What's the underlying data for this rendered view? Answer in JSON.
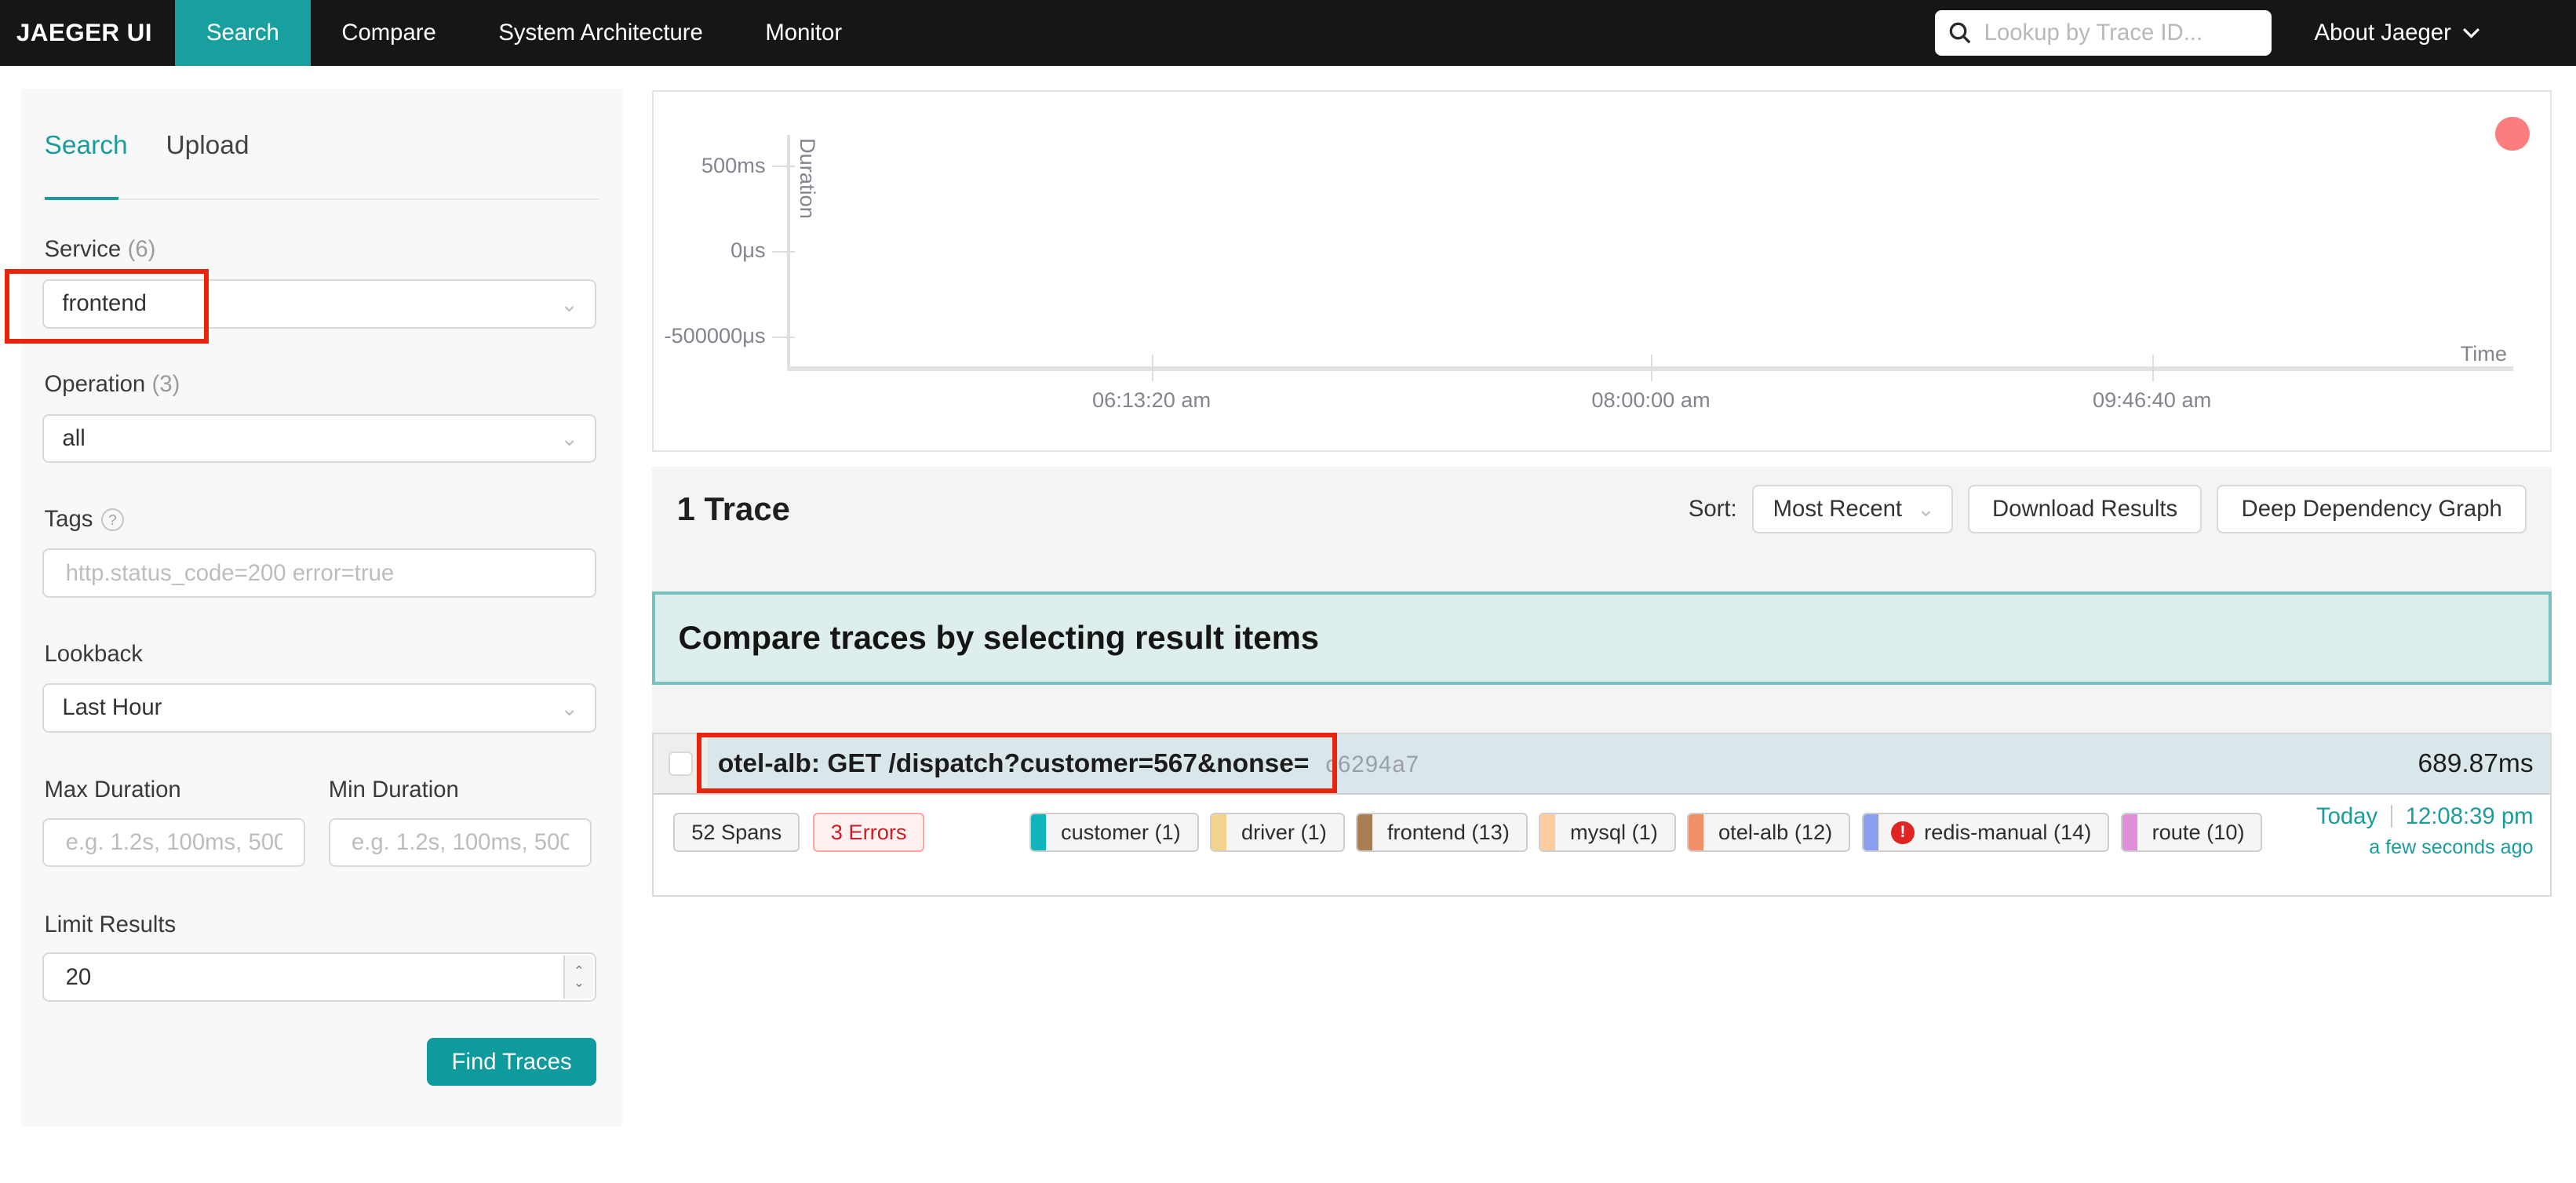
{
  "nav": {
    "brand": "JAEGER UI",
    "items": [
      {
        "label": "Search",
        "active": true
      },
      {
        "label": "Compare",
        "active": false
      },
      {
        "label": "System Architecture",
        "active": false
      },
      {
        "label": "Monitor",
        "active": false
      }
    ],
    "trace_lookup_placeholder": "Lookup by Trace ID...",
    "about_label": "About Jaeger"
  },
  "sidebar": {
    "tabs": [
      {
        "label": "Search",
        "active": true
      },
      {
        "label": "Upload",
        "active": false
      }
    ],
    "service": {
      "label": "Service",
      "count": "(6)",
      "value": "frontend"
    },
    "operation": {
      "label": "Operation",
      "count": "(3)",
      "value": "all"
    },
    "tags": {
      "label": "Tags",
      "help_icon": "?",
      "placeholder": "http.status_code=200 error=true"
    },
    "lookback": {
      "label": "Lookback",
      "value": "Last Hour"
    },
    "max_duration": {
      "label": "Max Duration",
      "placeholder": "e.g. 1.2s, 100ms, 500..."
    },
    "min_duration": {
      "label": "Min Duration",
      "placeholder": "e.g. 1.2s, 100ms, 500..."
    },
    "limit": {
      "label": "Limit Results",
      "value": "20"
    },
    "find_traces_label": "Find Traces"
  },
  "chart_data": {
    "type": "scatter",
    "title": "",
    "xlabel": "Time",
    "ylabel": "Duration",
    "x_ticks": [
      "06:13:20 am",
      "08:00:00 am",
      "09:46:40 am"
    ],
    "y_ticks": [
      "500ms",
      "0μs",
      "-500000μs"
    ],
    "grid": false,
    "legend": false,
    "points": [
      {
        "time": "12:08:39 pm",
        "duration_ms": 689.87,
        "color": "#fb7d7d"
      }
    ]
  },
  "results": {
    "count_label": "1 Trace",
    "sort_label": "Sort:",
    "sort_value": "Most Recent",
    "download_label": "Download Results",
    "deep_dependency_label": "Deep Dependency Graph",
    "compare_banner": "Compare traces by selecting result items"
  },
  "trace": {
    "title": "otel-alb: GET /dispatch?customer=567&nonse=",
    "trace_id_short": "c6294a7",
    "duration": "689.87ms",
    "span_count": "52 Spans",
    "error_count": "3 Errors",
    "services": [
      {
        "name": "customer (1)",
        "color": "#10b5b9",
        "error": false
      },
      {
        "name": "driver (1)",
        "color": "#f2d38d",
        "error": false
      },
      {
        "name": "frontend (13)",
        "color": "#a97e52",
        "error": false
      },
      {
        "name": "mysql (1)",
        "color": "#fbcd9d",
        "error": false
      },
      {
        "name": "otel-alb (12)",
        "color": "#f18f66",
        "error": false
      },
      {
        "name": "redis-manual (14)",
        "color": "#8b9ff1",
        "error": true
      },
      {
        "name": "route (10)",
        "color": "#df8fd7",
        "error": false
      }
    ],
    "date": "Today",
    "time": "12:08:39 pm",
    "relative_time": "a few seconds ago"
  },
  "colors": {
    "accent": "#18a0a0",
    "annotation": "#e8240c",
    "trace_header_bg": "#d9e7eb",
    "scatter_point": "#fb7d7d"
  }
}
